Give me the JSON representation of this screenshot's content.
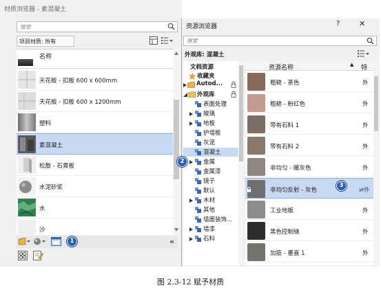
{
  "material_browser": {
    "title": "材质浏览器 - 素混凝土",
    "search_placeholder": "搜索",
    "filter_label": "项目材质: 所有",
    "list_header": "名称",
    "items": [
      {
        "label": "天花板 - 扣板 600 x 600mm",
        "swatch": "#e3e3e3"
      },
      {
        "label": "天花板 - 扣板 600 x 1200mm",
        "swatch": "#dcdcdc"
      },
      {
        "label": "塑料",
        "swatch": "#9a9a9a"
      },
      {
        "label": "素混凝土",
        "swatch": "#6b6b6b",
        "selected": true
      },
      {
        "label": "松散 - 石膏板",
        "swatch": "#d6d6d6"
      },
      {
        "label": "水泥砂浆",
        "swatch": "#8c8c8c"
      },
      {
        "label": "水",
        "swatch": "#2f7f4f"
      },
      {
        "label": "沙",
        "swatch": "#eeeeee"
      }
    ],
    "badge_1": "1",
    "collapse_glyph": "«"
  },
  "asset_browser": {
    "title": "资源浏览器",
    "help": "?",
    "close": "✕",
    "search_placeholder": "搜索",
    "library_label": "外观库: 混凝土",
    "tree": [
      {
        "label": "文档资源",
        "level": 0,
        "bold": true,
        "icon": "none",
        "toggle": ""
      },
      {
        "label": "收藏夹",
        "level": 0,
        "bold": true,
        "icon": "star",
        "toggle": ""
      },
      {
        "label": "Autod...",
        "level": 0,
        "bold": true,
        "icon": "folder",
        "toggle": "▶",
        "lock": true
      },
      {
        "label": "外观库",
        "level": 0,
        "bold": true,
        "icon": "folder",
        "toggle": "◢",
        "lock": true
      },
      {
        "label": "表面处理",
        "level": 1,
        "icon": "cube",
        "toggle": ""
      },
      {
        "label": "玻璃",
        "level": 1,
        "icon": "cube",
        "toggle": "▶"
      },
      {
        "label": "地板",
        "level": 1,
        "icon": "cube",
        "toggle": "▶"
      },
      {
        "label": "护墙板",
        "level": 1,
        "icon": "cube",
        "toggle": ""
      },
      {
        "label": "灰泥",
        "level": 1,
        "icon": "cube",
        "toggle": ""
      },
      {
        "label": "混凝土",
        "level": 1,
        "icon": "cube",
        "toggle": "",
        "selected": true
      },
      {
        "label": "金属",
        "level": 1,
        "icon": "cube",
        "toggle": "▶"
      },
      {
        "label": "金属漆",
        "level": 1,
        "icon": "cube",
        "toggle": ""
      },
      {
        "label": "镜子",
        "level": 1,
        "icon": "cube",
        "toggle": ""
      },
      {
        "label": "默认",
        "level": 1,
        "icon": "cube",
        "toggle": ""
      },
      {
        "label": "木材",
        "level": 1,
        "icon": "cube",
        "toggle": "▶"
      },
      {
        "label": "其他",
        "level": 1,
        "icon": "cube",
        "toggle": ""
      },
      {
        "label": "墙面装饰...",
        "level": 1,
        "icon": "cube",
        "toggle": ""
      },
      {
        "label": "墙漆",
        "level": 1,
        "icon": "cube",
        "toggle": "▶"
      },
      {
        "label": "石料",
        "level": 1,
        "icon": "cube",
        "toggle": "▶"
      }
    ],
    "column_name": "资源名称",
    "column_type": "特",
    "sort_glyph": "▲",
    "assets": [
      {
        "label": "粗糙 - 茶色",
        "type": "外",
        "color": "#8a6a58"
      },
      {
        "label": "粗糙 - 粉红色",
        "type": "外",
        "color": "#c49b90"
      },
      {
        "label": "带有石料 1",
        "type": "外",
        "color": "#7c7066"
      },
      {
        "label": "带有石料 2",
        "type": "外",
        "color": "#87796c"
      },
      {
        "label": "非均匀 - 暖灰色",
        "type": "外",
        "color": "#8e8881"
      },
      {
        "label": "非均匀反射 - 灰色",
        "type": "",
        "color": "#6f6f6f",
        "selected": true,
        "swap": "⇄外"
      },
      {
        "label": "工业地板",
        "type": "外",
        "color": "#8c8c8c"
      },
      {
        "label": "黑色控制缝",
        "type": "外",
        "color": "#2e2e2e"
      },
      {
        "label": "加筋 - 垂直 1",
        "type": "外",
        "color": "#77726c"
      }
    ],
    "badge_2": "2",
    "badge_3": "3"
  },
  "caption": "图 2.3-12 赋予材质"
}
